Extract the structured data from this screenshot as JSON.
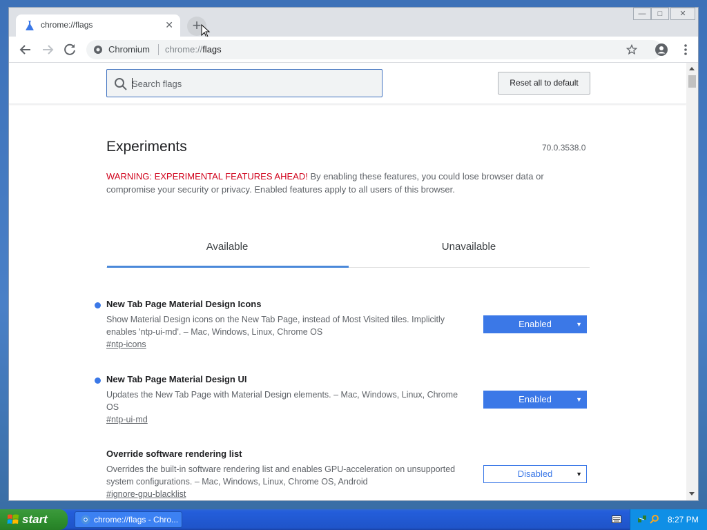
{
  "browser": {
    "tab": {
      "title": "chrome://flags",
      "close": "✕"
    },
    "new_tab": "+",
    "window_controls": {
      "minimize": "—",
      "maximize": "□",
      "close": "✕"
    },
    "omnibox": {
      "site": "Chromium",
      "scheme": "chrome://",
      "host": "flags"
    }
  },
  "page": {
    "search_placeholder": "Search flags",
    "reset_label": "Reset all to default",
    "title": "Experiments",
    "version": "70.0.3538.0",
    "warning_alert": "WARNING: EXPERIMENTAL FEATURES AHEAD!",
    "warning_text": " By enabling these features, you could lose browser data or compromise your security or privacy. Enabled features apply to all users of this browser.",
    "tabs": [
      {
        "label": "Available",
        "selected": true
      },
      {
        "label": "Unavailable",
        "selected": false
      }
    ],
    "flags": [
      {
        "name": "New Tab Page Material Design Icons",
        "description": "Show Material Design icons on the New Tab Page, instead of Most Visited tiles. Implicitly enables 'ntp-ui-md'. – Mac, Windows, Linux, Chrome OS",
        "link": "#ntp-icons",
        "state": "Enabled",
        "modified": true
      },
      {
        "name": "New Tab Page Material Design UI",
        "description": "Updates the New Tab Page with Material Design elements. – Mac, Windows, Linux, Chrome OS",
        "link": "#ntp-ui-md",
        "state": "Enabled",
        "modified": true
      },
      {
        "name": "Override software rendering list",
        "description": "Overrides the built-in software rendering list and enables GPU-acceleration on unsupported system configurations. – Mac, Windows, Linux, Chrome OS, Android",
        "link": "#ignore-gpu-blacklist",
        "state": "Disabled",
        "modified": false
      }
    ],
    "dropdown_arrow": "▼"
  },
  "taskbar": {
    "start_label": "start",
    "task_label": "chrome://flags - Chro...",
    "clock": "8:27 PM"
  },
  "colors": {
    "accent": "#3b78e7",
    "warning": "#d0021b",
    "taskbar": "#245edb",
    "start": "#2f8f2f"
  },
  "icons": [
    "flask-icon",
    "back-icon",
    "forward-icon",
    "reload-icon",
    "info-icon",
    "star-icon",
    "profile-icon",
    "menu-icon",
    "search-icon",
    "windows-logo-icon",
    "chromium-icon",
    "keyboard-icon"
  ]
}
